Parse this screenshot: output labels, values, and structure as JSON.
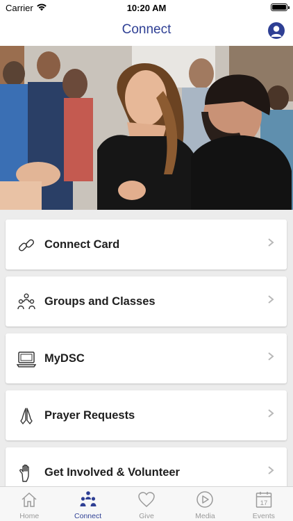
{
  "status_bar": {
    "carrier": "Carrier",
    "time": "10:20 AM"
  },
  "header": {
    "title": "Connect"
  },
  "hero": {
    "description_icon": "people-photo"
  },
  "menu": [
    {
      "label": "Connect Card",
      "icon": "link-icon"
    },
    {
      "label": "Groups and Classes",
      "icon": "group-icon"
    },
    {
      "label": "MyDSC",
      "icon": "laptop-icon"
    },
    {
      "label": "Prayer Requests",
      "icon": "praying-hands-icon"
    },
    {
      "label": "Get Involved & Volunteer",
      "icon": "raised-hand-icon"
    }
  ],
  "tabs": [
    {
      "label": "Home",
      "icon": "home-icon",
      "active": false
    },
    {
      "label": "Connect",
      "icon": "connect-icon",
      "active": true
    },
    {
      "label": "Give",
      "icon": "heart-icon",
      "active": false
    },
    {
      "label": "Media",
      "icon": "play-icon",
      "active": false
    },
    {
      "label": "Events",
      "icon": "calendar-icon",
      "active": false,
      "badge_text": "17"
    }
  ],
  "colors": {
    "accent": "#2e3f94",
    "inactive": "#9a9a9a",
    "background": "#ececec"
  }
}
